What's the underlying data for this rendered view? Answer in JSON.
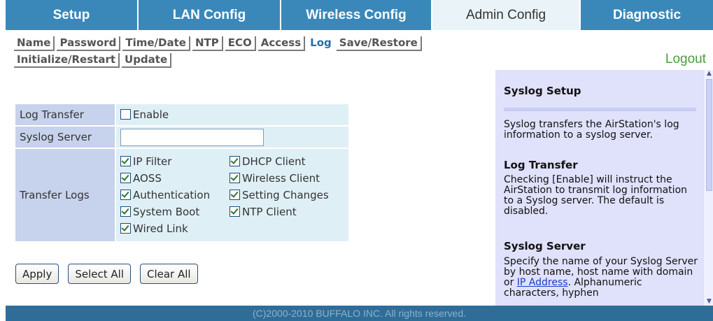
{
  "nav": {
    "tabs": [
      {
        "label": "Setup"
      },
      {
        "label": "LAN Config"
      },
      {
        "label": "Wireless Config"
      },
      {
        "label": "Admin Config"
      },
      {
        "label": "Diagnostic"
      }
    ],
    "active_tab": "Admin Config"
  },
  "subnav": {
    "items": [
      {
        "label": "Name"
      },
      {
        "label": "Password"
      },
      {
        "label": "Time/Date"
      },
      {
        "label": "NTP"
      },
      {
        "label": "ECO"
      },
      {
        "label": "Access"
      },
      {
        "label": "Log"
      },
      {
        "label": "Save/Restore"
      },
      {
        "label": "Initialize/Restart"
      },
      {
        "label": "Update"
      }
    ],
    "active": "Log",
    "logout": "Logout"
  },
  "form": {
    "log_transfer_label": "Log Transfer",
    "enable_label": "Enable",
    "enable_checked": false,
    "syslog_server_label": "Syslog Server",
    "syslog_server_value": "",
    "transfer_logs_label": "Transfer Logs",
    "logs": [
      {
        "label": "IP Filter",
        "checked": true
      },
      {
        "label": "DHCP Client",
        "checked": true
      },
      {
        "label": "AOSS",
        "checked": true
      },
      {
        "label": "Wireless Client",
        "checked": true
      },
      {
        "label": "Authentication",
        "checked": true
      },
      {
        "label": "Setting Changes",
        "checked": true
      },
      {
        "label": "System Boot",
        "checked": true
      },
      {
        "label": "NTP Client",
        "checked": true
      },
      {
        "label": "Wired Link",
        "checked": true
      }
    ]
  },
  "buttons": {
    "apply": "Apply",
    "select_all": "Select All",
    "clear_all": "Clear All"
  },
  "help": {
    "title": "Syslog Setup",
    "intro": "Syslog transfers the AirStation's log information to a syslog server.",
    "log_transfer_heading": "Log Transfer",
    "log_transfer_text": "Checking [Enable] will instruct the AirStation to transmit log information to a Syslog server. The default is disabled.",
    "syslog_server_heading": "Syslog Server",
    "syslog_server_text_before": "Specify the name of your Syslog Server by host name, host name with domain or ",
    "syslog_server_link": "IP Address",
    "syslog_server_text_after": ". Alphanumeric characters, hyphen"
  },
  "footer": "(C)2000-2010 BUFFALO INC. All rights reserved."
}
